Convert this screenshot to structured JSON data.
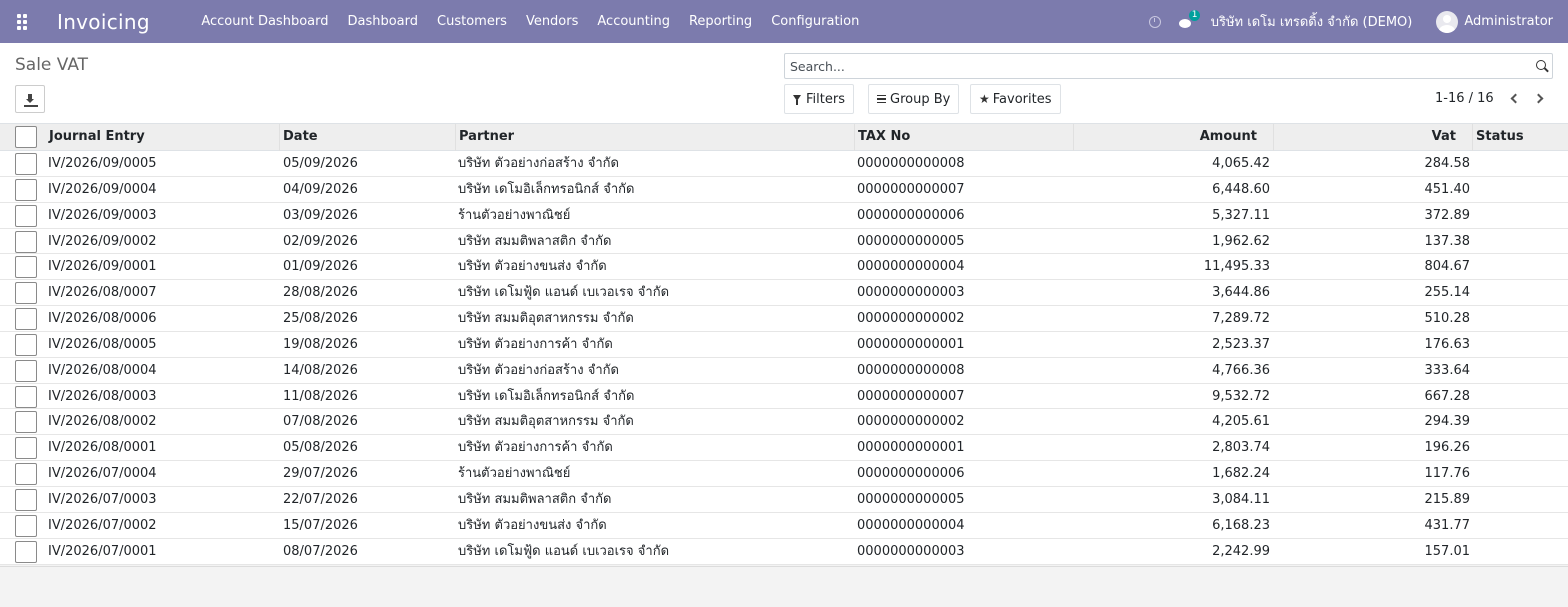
{
  "navbar": {
    "brand": "Invoicing",
    "menu": [
      "Account Dashboard",
      "Dashboard",
      "Customers",
      "Vendors",
      "Accounting",
      "Reporting",
      "Configuration"
    ],
    "chat_count": "1",
    "company": "บริษัท เดโม เทรดดิ้ง จำกัด (DEMO)",
    "user": "Administrator"
  },
  "control": {
    "title": "Sale VAT",
    "search_placeholder": "Search...",
    "filters_label": "Filters",
    "group_by_label": "Group By",
    "favorites_label": "Favorites",
    "pager": "1-16 / 16"
  },
  "table": {
    "columns": [
      "Journal Entry",
      "Date",
      "Partner",
      "TAX No",
      "Amount",
      "Vat",
      "Status"
    ],
    "rows": [
      [
        "IV/2026/09/0005",
        "05/09/2026",
        "บริษัท ตัวอย่างก่อสร้าง จำกัด",
        "0000000000008",
        "4,065.42",
        "284.58",
        ""
      ],
      [
        "IV/2026/09/0004",
        "04/09/2026",
        "บริษัท เดโมอิเล็กทรอนิกส์ จำกัด",
        "0000000000007",
        "6,448.60",
        "451.40",
        ""
      ],
      [
        "IV/2026/09/0003",
        "03/09/2026",
        "ร้านตัวอย่างพาณิชย์",
        "0000000000006",
        "5,327.11",
        "372.89",
        ""
      ],
      [
        "IV/2026/09/0002",
        "02/09/2026",
        "บริษัท สมมติพลาสติก จำกัด",
        "0000000000005",
        "1,962.62",
        "137.38",
        ""
      ],
      [
        "IV/2026/09/0001",
        "01/09/2026",
        "บริษัท ตัวอย่างขนส่ง จำกัด",
        "0000000000004",
        "11,495.33",
        "804.67",
        ""
      ],
      [
        "IV/2026/08/0007",
        "28/08/2026",
        "บริษัท เดโมฟู้ด แอนด์ เบเวอเรจ จำกัด",
        "0000000000003",
        "3,644.86",
        "255.14",
        ""
      ],
      [
        "IV/2026/08/0006",
        "25/08/2026",
        "บริษัท สมมติอุตสาหกรรม จำกัด",
        "0000000000002",
        "7,289.72",
        "510.28",
        ""
      ],
      [
        "IV/2026/08/0005",
        "19/08/2026",
        "บริษัท ตัวอย่างการค้า จำกัด",
        "0000000000001",
        "2,523.37",
        "176.63",
        ""
      ],
      [
        "IV/2026/08/0004",
        "14/08/2026",
        "บริษัท ตัวอย่างก่อสร้าง จำกัด",
        "0000000000008",
        "4,766.36",
        "333.64",
        ""
      ],
      [
        "IV/2026/08/0003",
        "11/08/2026",
        "บริษัท เดโมอิเล็กทรอนิกส์ จำกัด",
        "0000000000007",
        "9,532.72",
        "667.28",
        ""
      ],
      [
        "IV/2026/08/0002",
        "07/08/2026",
        "บริษัท สมมติอุตสาหกรรม จำกัด",
        "0000000000002",
        "4,205.61",
        "294.39",
        ""
      ],
      [
        "IV/2026/08/0001",
        "05/08/2026",
        "บริษัท ตัวอย่างการค้า จำกัด",
        "0000000000001",
        "2,803.74",
        "196.26",
        ""
      ],
      [
        "IV/2026/07/0004",
        "29/07/2026",
        "ร้านตัวอย่างพาณิชย์",
        "0000000000006",
        "1,682.24",
        "117.76",
        ""
      ],
      [
        "IV/2026/07/0003",
        "22/07/2026",
        "บริษัท สมมติพลาสติก จำกัด",
        "0000000000005",
        "3,084.11",
        "215.89",
        ""
      ],
      [
        "IV/2026/07/0002",
        "15/07/2026",
        "บริษัท ตัวอย่างขนส่ง จำกัด",
        "0000000000004",
        "6,168.23",
        "431.77",
        ""
      ],
      [
        "IV/2026/07/0001",
        "08/07/2026",
        "บริษัท เดโมฟู้ด แอนด์ เบเวอเรจ จำกัด",
        "0000000000003",
        "2,242.99",
        "157.01",
        ""
      ]
    ]
  },
  "colors": {
    "navbar": "#7c7bad",
    "accent": "#00a09d"
  }
}
